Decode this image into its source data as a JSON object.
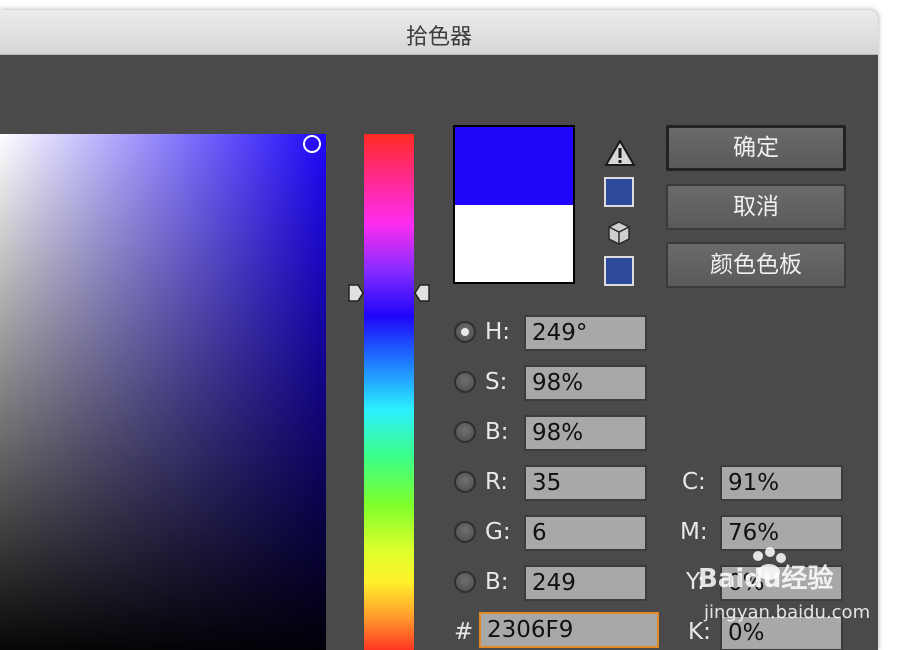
{
  "window": {
    "title": "拾色器"
  },
  "colors": {
    "new_color": "#1f06f9",
    "original_color": "#ffffff",
    "web_safe_swatch": "#2e4a9a",
    "cmyk_swatch": "#2e4a9a"
  },
  "buttons": {
    "ok": "确定",
    "cancel": "取消",
    "swatches": "颜色色板"
  },
  "hsb": [
    {
      "label": "H:",
      "value": "249°",
      "selected": true
    },
    {
      "label": "S:",
      "value": "98%",
      "selected": false
    },
    {
      "label": "B:",
      "value": "98%",
      "selected": false
    }
  ],
  "rgb": [
    {
      "label": "R:",
      "value": "35",
      "selected": false
    },
    {
      "label": "G:",
      "value": "6",
      "selected": false
    },
    {
      "label": "B:",
      "value": "249",
      "selected": false
    }
  ],
  "cmyk": [
    {
      "label": "C:",
      "value": "91%"
    },
    {
      "label": "M:",
      "value": "76%"
    },
    {
      "label": "Y:",
      "value": "0%"
    },
    {
      "label": "K:",
      "value": "0%"
    }
  ],
  "hex": {
    "label": "#",
    "value": "2306F9"
  },
  "icons": {
    "out_of_gamut": "warning-triangle-icon",
    "web_safe": "cube-icon",
    "hue_slider": "slider-arrow-icon"
  },
  "watermark": {
    "brand": "Baidu经验",
    "url": "jingyan.baidu.com"
  }
}
